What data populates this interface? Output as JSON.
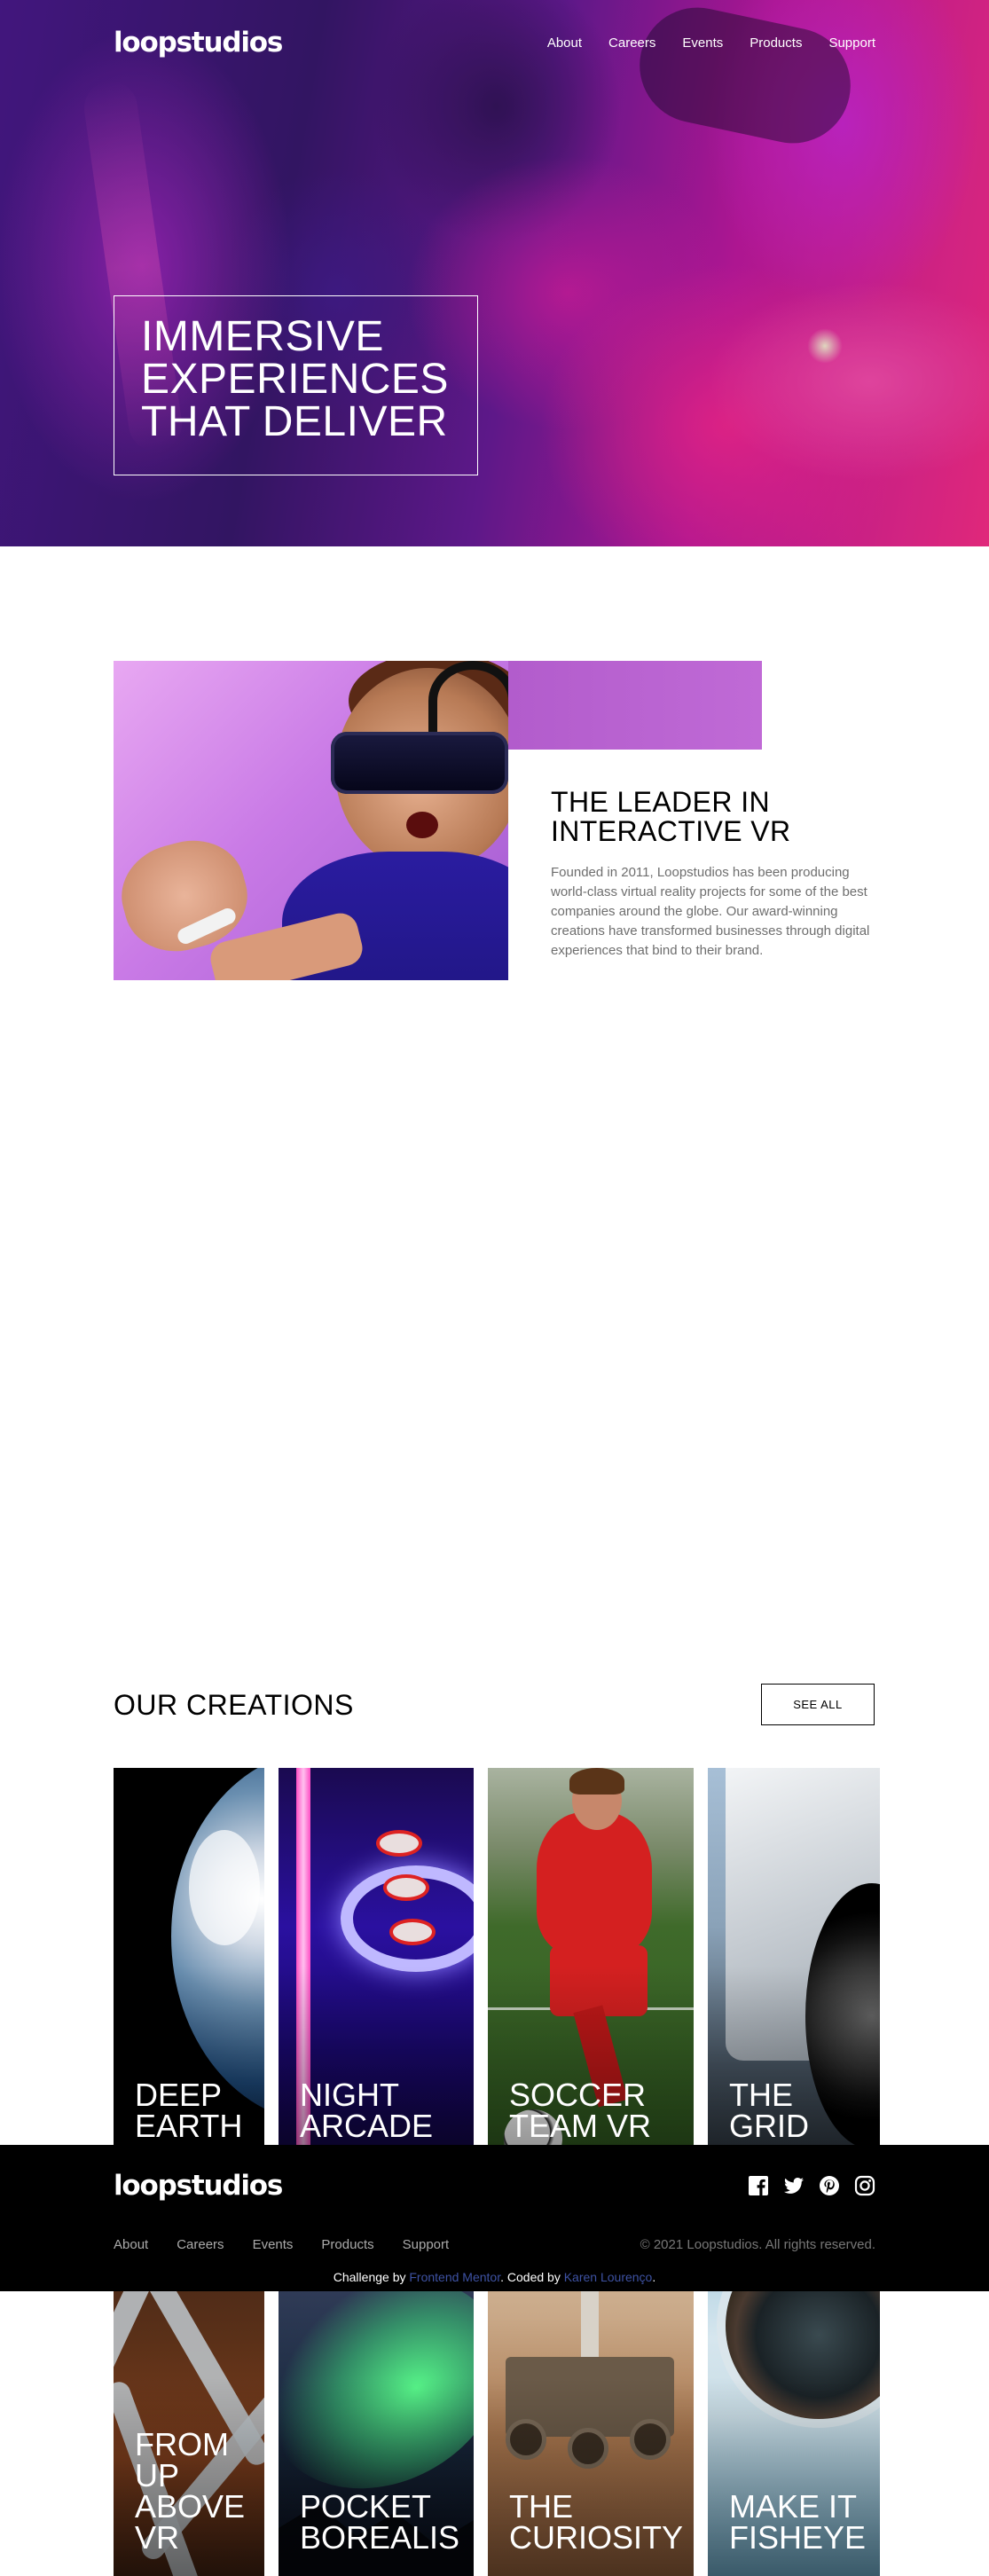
{
  "header": {
    "logo": "loopstudios",
    "nav": [
      "About",
      "Careers",
      "Events",
      "Products",
      "Support"
    ]
  },
  "hero": {
    "title": "IMMERSIVE EXPERIENCES THAT DELIVER"
  },
  "interactive": {
    "title": "THE LEADER IN INTERACTIVE VR",
    "body": "Founded in 2011, Loopstudios has been producing world-class virtual reality projects for some of the best companies around the globe. Our award-winning creations have transformed businesses through digital experiences that bind to their brand."
  },
  "creations": {
    "title": "OUR CREATIONS",
    "see_all": "SEE ALL",
    "items": [
      {
        "label": "DEEP EARTH"
      },
      {
        "label": "NIGHT ARCADE"
      },
      {
        "label": "SOCCER TEAM VR"
      },
      {
        "label": "THE GRID"
      },
      {
        "label": "FROM UP ABOVE VR"
      },
      {
        "label": "POCKET BOREALIS"
      },
      {
        "label": "THE CURIOSITY"
      },
      {
        "label": "MAKE IT FISHEYE"
      }
    ]
  },
  "footer": {
    "logo": "loopstudios",
    "nav": [
      "About",
      "Careers",
      "Events",
      "Products",
      "Support"
    ],
    "copyright": "© 2021 Loopstudios. All rights reserved.",
    "attribution_prefix": "Challenge by",
    "attribution_link1": "Frontend Mentor",
    "attribution_mid": ". Coded by",
    "attribution_link2": "Karen Lourenço",
    "attribution_suffix": ".",
    "social_icons": [
      "facebook-icon",
      "twitter-icon",
      "pinterest-icon",
      "instagram-icon"
    ]
  }
}
